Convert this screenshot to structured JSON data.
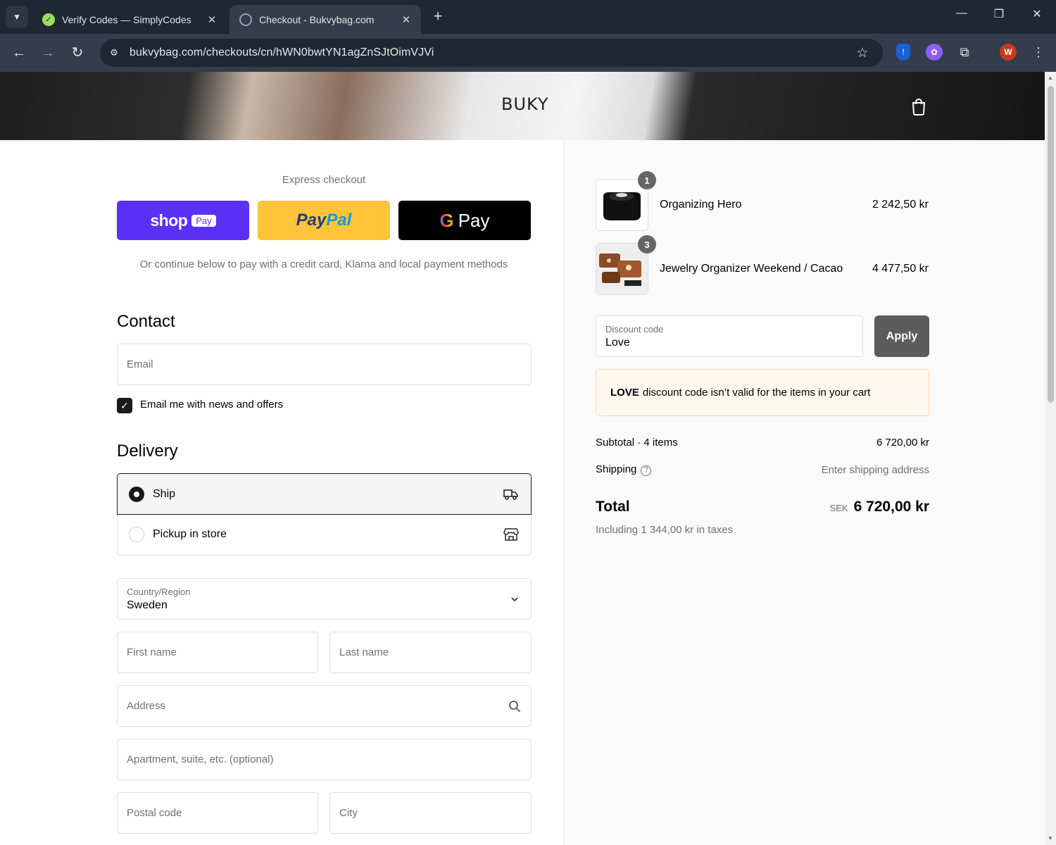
{
  "browser": {
    "tabs": [
      {
        "title": "Verify Codes — SimplyCodes",
        "active": false
      },
      {
        "title": "Checkout - Bukvybag.com",
        "active": true
      }
    ],
    "url": "bukvybag.com/checkouts/cn/hWN0bwtYN1agZnSJtOimVJVi",
    "profile_initial": "W",
    "icons": [
      "chevron-down-icon",
      "close-icon",
      "plus-icon",
      "minimize-icon",
      "restore-icon",
      "back-icon",
      "forward-icon",
      "reload-icon",
      "site-settings-icon",
      "star-icon",
      "shield-extension-icon",
      "extension-icon",
      "puzzle-icon",
      "more-icon"
    ]
  },
  "store": {
    "logo": "BUKY"
  },
  "express": {
    "title": "Express checkout",
    "shop_label": "shop",
    "shop_pay": "Pay",
    "paypal_a": "Pay",
    "paypal_b": "Pal",
    "gpay_g": "G",
    "gpay_label": "Pay",
    "note": "Or continue below to pay with a credit card, Klarna and local payment methods"
  },
  "contact": {
    "heading": "Contact",
    "email_placeholder": "Email",
    "news_label": "Email me with news and offers",
    "news_checked": true
  },
  "delivery": {
    "heading": "Delivery",
    "options": [
      {
        "label": "Ship",
        "selected": true,
        "icon": "truck-icon"
      },
      {
        "label": "Pickup in store",
        "selected": false,
        "icon": "store-icon"
      }
    ],
    "country_label": "Country/Region",
    "country_value": "Sweden",
    "first_name": "First name",
    "last_name": "Last name",
    "address": "Address",
    "apartment": "Apartment, suite, etc. (optional)",
    "postal": "Postal code",
    "city": "City"
  },
  "cart": {
    "items": [
      {
        "name": "Organizing Hero",
        "qty": "1",
        "price": "2 242,50 kr"
      },
      {
        "name": "Jewelry Organizer Weekend / Cacao",
        "qty": "3",
        "price": "4 477,50 kr"
      }
    ],
    "discount_label": "Discount code",
    "discount_value": "Love",
    "apply": "Apply",
    "error_code": "LOVE",
    "error_msg": "discount code isn’t valid for the items in your cart",
    "subtotal_label": "Subtotal · 4 items",
    "subtotal_value": "6 720,00 kr",
    "shipping_label": "Shipping",
    "shipping_value": "Enter shipping address",
    "total_label": "Total",
    "total_currency": "SEK",
    "total_value": "6 720,00 kr",
    "taxes": "Including 1 344,00 kr in taxes"
  }
}
